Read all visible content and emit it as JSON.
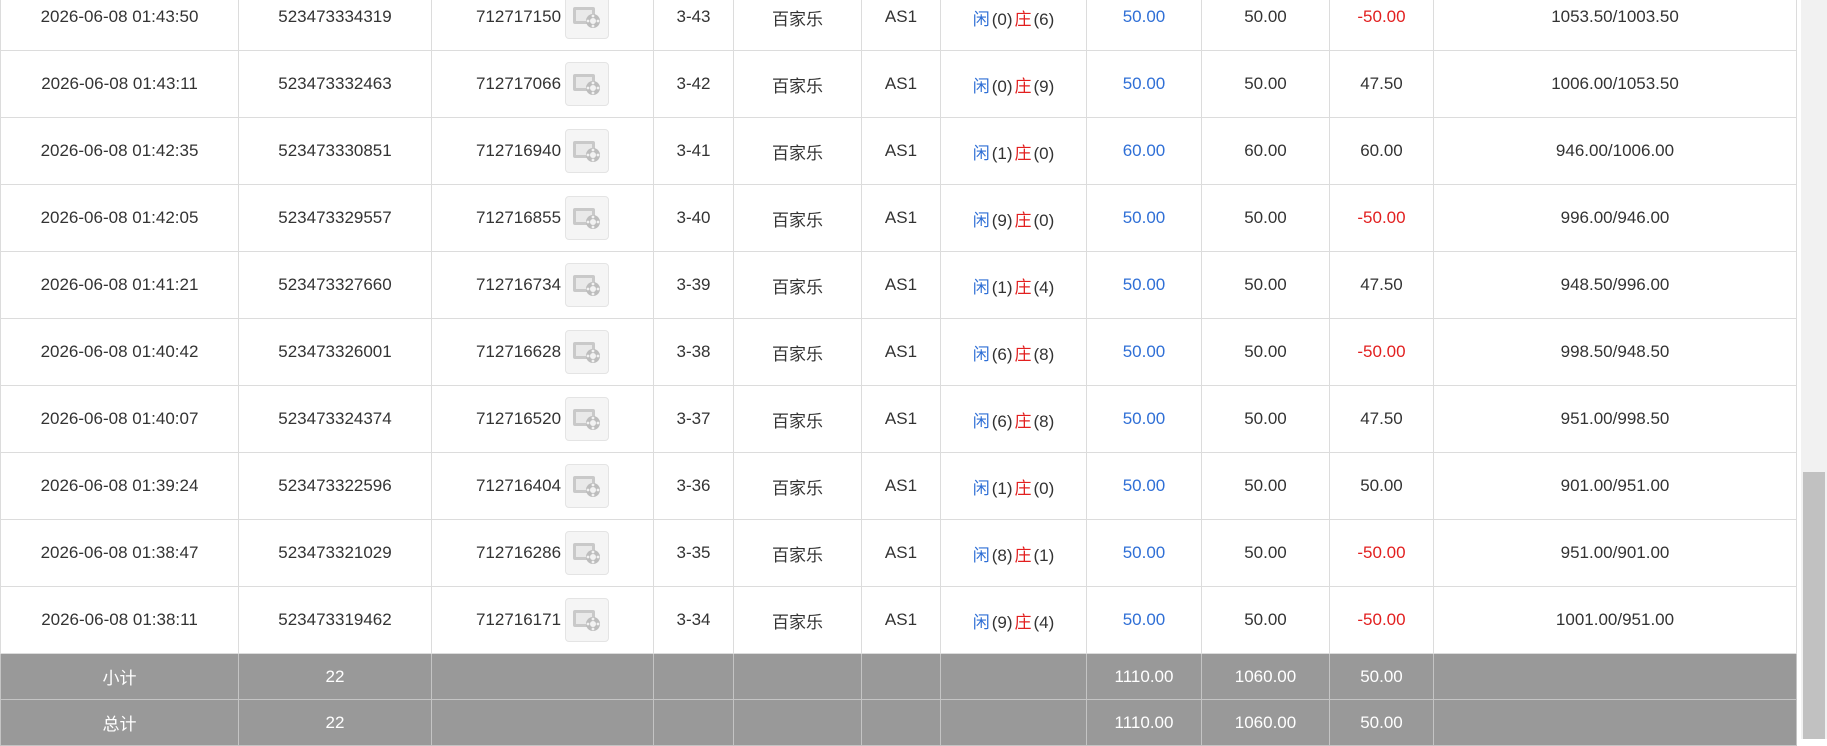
{
  "rows": [
    {
      "time": "2026-06-08 01:43:50",
      "bet_id": "523473334319",
      "round": "712717150",
      "shoe": "3-43",
      "game": "百家乐",
      "table": "AS1",
      "player_label": "闲",
      "player_pts": "(0)",
      "banker_label": "庄",
      "banker_pts": "(6)",
      "bet": "50.00",
      "valid": "50.00",
      "win": "-50.00",
      "balance": "1053.50/1003.50",
      "win_negative": true
    },
    {
      "time": "2026-06-08 01:43:11",
      "bet_id": "523473332463",
      "round": "712717066",
      "shoe": "3-42",
      "game": "百家乐",
      "table": "AS1",
      "player_label": "闲",
      "player_pts": "(0)",
      "banker_label": "庄",
      "banker_pts": "(9)",
      "bet": "50.00",
      "valid": "50.00",
      "win": "47.50",
      "balance": "1006.00/1053.50",
      "win_negative": false
    },
    {
      "time": "2026-06-08 01:42:35",
      "bet_id": "523473330851",
      "round": "712716940",
      "shoe": "3-41",
      "game": "百家乐",
      "table": "AS1",
      "player_label": "闲",
      "player_pts": "(1)",
      "banker_label": "庄",
      "banker_pts": "(0)",
      "bet": "60.00",
      "valid": "60.00",
      "win": "60.00",
      "balance": "946.00/1006.00",
      "win_negative": false
    },
    {
      "time": "2026-06-08 01:42:05",
      "bet_id": "523473329557",
      "round": "712716855",
      "shoe": "3-40",
      "game": "百家乐",
      "table": "AS1",
      "player_label": "闲",
      "player_pts": "(9)",
      "banker_label": "庄",
      "banker_pts": "(0)",
      "bet": "50.00",
      "valid": "50.00",
      "win": "-50.00",
      "balance": "996.00/946.00",
      "win_negative": true
    },
    {
      "time": "2026-06-08 01:41:21",
      "bet_id": "523473327660",
      "round": "712716734",
      "shoe": "3-39",
      "game": "百家乐",
      "table": "AS1",
      "player_label": "闲",
      "player_pts": "(1)",
      "banker_label": "庄",
      "banker_pts": "(4)",
      "bet": "50.00",
      "valid": "50.00",
      "win": "47.50",
      "balance": "948.50/996.00",
      "win_negative": false
    },
    {
      "time": "2026-06-08 01:40:42",
      "bet_id": "523473326001",
      "round": "712716628",
      "shoe": "3-38",
      "game": "百家乐",
      "table": "AS1",
      "player_label": "闲",
      "player_pts": "(6)",
      "banker_label": "庄",
      "banker_pts": "(8)",
      "bet": "50.00",
      "valid": "50.00",
      "win": "-50.00",
      "balance": "998.50/948.50",
      "win_negative": true
    },
    {
      "time": "2026-06-08 01:40:07",
      "bet_id": "523473324374",
      "round": "712716520",
      "shoe": "3-37",
      "game": "百家乐",
      "table": "AS1",
      "player_label": "闲",
      "player_pts": "(6)",
      "banker_label": "庄",
      "banker_pts": "(8)",
      "bet": "50.00",
      "valid": "50.00",
      "win": "47.50",
      "balance": "951.00/998.50",
      "win_negative": false
    },
    {
      "time": "2026-06-08 01:39:24",
      "bet_id": "523473322596",
      "round": "712716404",
      "shoe": "3-36",
      "game": "百家乐",
      "table": "AS1",
      "player_label": "闲",
      "player_pts": "(1)",
      "banker_label": "庄",
      "banker_pts": "(0)",
      "bet": "50.00",
      "valid": "50.00",
      "win": "50.00",
      "balance": "901.00/951.00",
      "win_negative": false
    },
    {
      "time": "2026-06-08 01:38:47",
      "bet_id": "523473321029",
      "round": "712716286",
      "shoe": "3-35",
      "game": "百家乐",
      "table": "AS1",
      "player_label": "闲",
      "player_pts": "(8)",
      "banker_label": "庄",
      "banker_pts": "(1)",
      "bet": "50.00",
      "valid": "50.00",
      "win": "-50.00",
      "balance": "951.00/901.00",
      "win_negative": true
    },
    {
      "time": "2026-06-08 01:38:11",
      "bet_id": "523473319462",
      "round": "712716171",
      "shoe": "3-34",
      "game": "百家乐",
      "table": "AS1",
      "player_label": "闲",
      "player_pts": "(9)",
      "banker_label": "庄",
      "banker_pts": "(4)",
      "bet": "50.00",
      "valid": "50.00",
      "win": "-50.00",
      "balance": "1001.00/951.00",
      "win_negative": true
    }
  ],
  "subtotal": {
    "label": "小计",
    "count": "22",
    "bet": "1110.00",
    "valid": "1060.00",
    "win": "50.00"
  },
  "total": {
    "label": "总计",
    "count": "22",
    "bet": "1110.00",
    "valid": "1060.00",
    "win": "50.00"
  },
  "icons": {
    "replay": "video-replay-icon"
  },
  "colors": {
    "player": "#2f6fd6",
    "banker": "#e21f1f",
    "negative": "#e21f1f",
    "bet_amount": "#2f6fd6",
    "summary_bg": "#999999"
  }
}
